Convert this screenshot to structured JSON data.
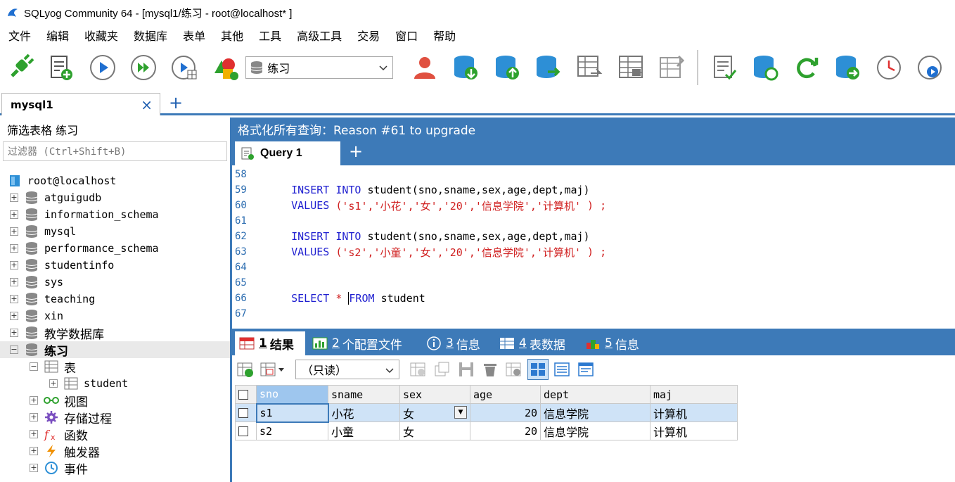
{
  "window": {
    "title": "SQLyog Community 64 - [mysql1/练习 - root@localhost* ]"
  },
  "menu": [
    "文件",
    "编辑",
    "收藏夹",
    "数据库",
    "表单",
    "其他",
    "工具",
    "高级工具",
    "交易",
    "窗口",
    "帮助"
  ],
  "toolbar": {
    "database_selected": "练习"
  },
  "connection_tab": {
    "label": "mysql1",
    "close": "×",
    "add": "+"
  },
  "left_panel": {
    "header": "筛选表格 练习",
    "filter_placeholder": "过滤器 (Ctrl+Shift+B)",
    "root": "root@localhost",
    "databases": [
      "atguigudb",
      "information_schema",
      "mysql",
      "performance_schema",
      "studentinfo",
      "sys",
      "teaching",
      "xin",
      "教学数据库"
    ],
    "expanded_db": "练习",
    "folders": [
      "表",
      "视图",
      "存储过程",
      "函数",
      "触发器",
      "事件"
    ],
    "table": "student"
  },
  "right_panel": {
    "header": "格式化所有查询：Reason #61 to upgrade",
    "query_tab": "Query 1",
    "add": "+"
  },
  "editor": {
    "line_numbers": [
      "58",
      "59",
      "60",
      "61",
      "62",
      "63",
      "64",
      "65",
      "66",
      "67"
    ],
    "l59": {
      "kw1": "INSERT",
      "kw2": "INTO",
      "rest": "student(sno,sname,sex,age,dept,maj)"
    },
    "l60": {
      "kw": "VALUES",
      "open": "(",
      "vals": "'s1','小花','女','20','信息学院','计算机'",
      "close": " ) ;"
    },
    "l62": {
      "kw1": "INSERT",
      "kw2": "INTO",
      "rest": "student(sno,sname,sex,age,dept,maj)"
    },
    "l63": {
      "kw": "VALUES",
      "open": "(",
      "vals": "'s2','小童','女','20','信息学院','计算机'",
      "close": " ) ;"
    },
    "l66": {
      "kw1": "SELECT",
      "star": "*",
      "kw2": "FROM",
      "rest": "student"
    }
  },
  "result_tabs": [
    {
      "num": "1",
      "label": "结果"
    },
    {
      "num": "2",
      "label": "个配置文件"
    },
    {
      "num": "3",
      "label": "信息"
    },
    {
      "num": "4",
      "label": "表数据"
    },
    {
      "num": "5",
      "label": "信息"
    }
  ],
  "result_toolbar": {
    "mode": "（只读）"
  },
  "grid": {
    "columns": [
      "sno",
      "sname",
      "sex",
      "age",
      "dept",
      "maj"
    ],
    "rows": [
      {
        "sno": "s1",
        "sname": "小花",
        "sex": "女",
        "age": "20",
        "dept": "信息学院",
        "maj": "计算机"
      },
      {
        "sno": "s2",
        "sname": "小童",
        "sex": "女",
        "age": "20",
        "dept": "信息学院",
        "maj": "计算机"
      }
    ]
  },
  "colors": {
    "accent": "#3d7ab8",
    "keyword": "#1f1fd0",
    "string": "#d02020",
    "green": "#2ea12e"
  }
}
